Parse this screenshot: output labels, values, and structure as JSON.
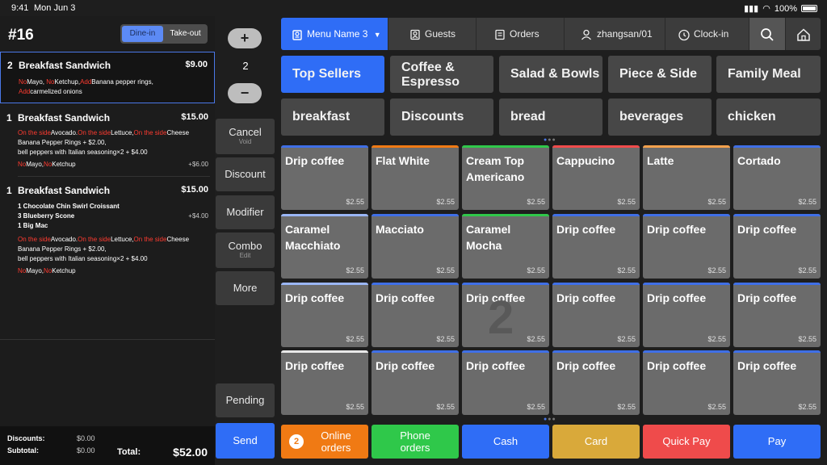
{
  "status_bar": {
    "time": "9:41",
    "date": "Mon Jun 3",
    "battery": "100%"
  },
  "order": {
    "number": "#16",
    "mode_options": [
      "Dine-in",
      "Take-out"
    ],
    "items": [
      {
        "qty": "2",
        "name": "Breakfast Sandwich",
        "price": "$9.00",
        "modifier_lines": [
          [
            {
              "t": "No",
              "c": "red"
            },
            {
              "t": "Mayo, ",
              "c": "white"
            },
            {
              "t": "No",
              "c": "red"
            },
            {
              "t": "Ketchup,",
              "c": "white"
            },
            {
              "t": "Add",
              "c": "red"
            },
            {
              "t": "Banana pepper rings,",
              "c": "white"
            }
          ],
          [
            {
              "t": "Add",
              "c": "red"
            },
            {
              "t": "carmelized onions",
              "c": "white"
            }
          ]
        ]
      },
      {
        "qty": "1",
        "name": "Breakfast Sandwich",
        "price": "$15.00",
        "modifier_lines": [
          [
            {
              "t": "On the side",
              "c": "red"
            },
            {
              "t": "Avocado.",
              "c": "white"
            },
            {
              "t": "On the side",
              "c": "red"
            },
            {
              "t": "Lettuce,",
              "c": "white"
            },
            {
              "t": "On the side",
              "c": "red"
            },
            {
              "t": "Cheese",
              "c": "white"
            }
          ],
          [
            {
              "t": "Banana Pepper Rings + $2.00,",
              "c": "white"
            }
          ],
          [
            {
              "t": "bell peppers with Italian seasoning×2 + $4.00",
              "c": "white"
            }
          ],
          [
            {
              "t": "No",
              "c": "red"
            },
            {
              "t": "Mayo,",
              "c": "white"
            },
            {
              "t": "No",
              "c": "red"
            },
            {
              "t": "Ketchup",
              "c": "white"
            }
          ]
        ],
        "extra_price": "+$6.00"
      },
      {
        "qty": "1",
        "name": "Breakfast Sandwich",
        "price": "$15.00",
        "combo_lines": [
          "1 Chocolate Chin Swirl Croissant",
          "3 Blueberry Scone",
          "1 Big Mac"
        ],
        "combo_price": "+$4.00",
        "modifier_lines": [
          [
            {
              "t": "On the side",
              "c": "red"
            },
            {
              "t": "Avocado.",
              "c": "white"
            },
            {
              "t": "On the side",
              "c": "red"
            },
            {
              "t": "Lettuce,",
              "c": "white"
            },
            {
              "t": "On the side",
              "c": "red"
            },
            {
              "t": "Cheese",
              "c": "white"
            }
          ],
          [
            {
              "t": "Banana Pepper Rings + $2.00,",
              "c": "white"
            }
          ],
          [
            {
              "t": "bell peppers with Italian seasoning×2 + $4.00",
              "c": "white"
            }
          ],
          [
            {
              "t": "No",
              "c": "red"
            },
            {
              "t": "Mayo,",
              "c": "white"
            },
            {
              "t": "No",
              "c": "red"
            },
            {
              "t": "Ketchup",
              "c": "white"
            }
          ]
        ]
      }
    ],
    "footer": {
      "discounts_label": "Discounts:",
      "discounts_value": "$0.00",
      "subtotal_label": "Subtotal:",
      "subtotal_value": "$0.00",
      "total_label": "Total:",
      "total_value": "$52.00"
    }
  },
  "actions": {
    "plus": "+",
    "minus": "−",
    "quantity": "2",
    "cancel": {
      "label": "Cancel",
      "sub": "Void"
    },
    "discount": "Discount",
    "modifier": "Modifier",
    "combo": {
      "label": "Combo",
      "sub": "Edit"
    },
    "more": "More",
    "pending": "Pending",
    "send": "Send"
  },
  "topbar": {
    "menu_name": "Menu Name 3",
    "guests": "Guests",
    "orders": "Orders",
    "user": "zhangsan/01",
    "clock_in": "Clock-in"
  },
  "categories": [
    "Top Sellers",
    "Coffee & Espresso",
    "Salad & Bowls",
    "Piece & Side",
    "Family Meal",
    "breakfast",
    "Discounts",
    "bread",
    "beverages",
    "chicken"
  ],
  "products": [
    {
      "name": "Drip coffee",
      "price": "$2.55",
      "color": "#3f6fe6"
    },
    {
      "name": "Flat White",
      "price": "$2.55",
      "color": "#f07a14"
    },
    {
      "name": "Cream Top Americano",
      "price": "$2.55",
      "color": "#2fc84a"
    },
    {
      "name": "Cappucino",
      "price": "$2.55",
      "color": "#ef4b4b"
    },
    {
      "name": "Latte",
      "price": "$2.55",
      "color": "#f5a14d"
    },
    {
      "name": "Cortado",
      "price": "$2.55",
      "color": "#3f6fe6"
    },
    {
      "name": "Caramel Macchiato",
      "price": "$2.55",
      "color": "#9ab6f5"
    },
    {
      "name": "Macciato",
      "price": "$2.55",
      "color": "#3f6fe6"
    },
    {
      "name": "Caramel Mocha",
      "price": "$2.55",
      "color": "#2fc84a"
    },
    {
      "name": "Drip coffee",
      "price": "$2.55",
      "color": "#3f6fe6"
    },
    {
      "name": "Drip coffee",
      "price": "$2.55",
      "color": "#3f6fe6"
    },
    {
      "name": "Drip coffee",
      "price": "$2.55",
      "color": "#3f6fe6"
    },
    {
      "name": "Drip coffee",
      "price": "$2.55",
      "color": "#9ab6f5"
    },
    {
      "name": "Drip coffee",
      "price": "$2.55",
      "color": "#3f6fe6"
    },
    {
      "name": "Drip coffee",
      "price": "$2.55",
      "color": "#3f6fe6"
    },
    {
      "name": "Drip coffee",
      "price": "$2.55",
      "color": "#3f6fe6"
    },
    {
      "name": "Drip coffee",
      "price": "$2.55",
      "color": "#3f6fe6"
    },
    {
      "name": "Drip coffee",
      "price": "$2.55",
      "color": "#3f6fe6"
    },
    {
      "name": "Drip coffee",
      "price": "$2.55",
      "color": "#e8e8e8"
    },
    {
      "name": "Drip coffee",
      "price": "$2.55",
      "color": "#3f6fe6"
    },
    {
      "name": "Drip coffee",
      "price": "$2.55",
      "color": "#3f6fe6"
    },
    {
      "name": "Drip coffee",
      "price": "$2.55",
      "color": "#3f6fe6"
    },
    {
      "name": "Drip coffee",
      "price": "$2.55",
      "color": "#3f6fe6"
    },
    {
      "name": "Drip coffee",
      "price": "$2.55",
      "color": "#3f6fe6"
    }
  ],
  "grid_page_overlay": "2",
  "bottom_buttons": [
    {
      "label": "Online orders",
      "badge": "2",
      "color": "#f07a14"
    },
    {
      "label": "Phone orders",
      "color": "#2fc84a"
    },
    {
      "label": "Cash",
      "color": "#2f6df6"
    },
    {
      "label": "Card",
      "color": "#d9a93a"
    },
    {
      "label": "Quick Pay",
      "color": "#ef4b4b"
    },
    {
      "label": "Pay",
      "color": "#2f6df6"
    }
  ],
  "colors": {
    "accent": "#2f6df6",
    "danger": "#ff3b30"
  }
}
